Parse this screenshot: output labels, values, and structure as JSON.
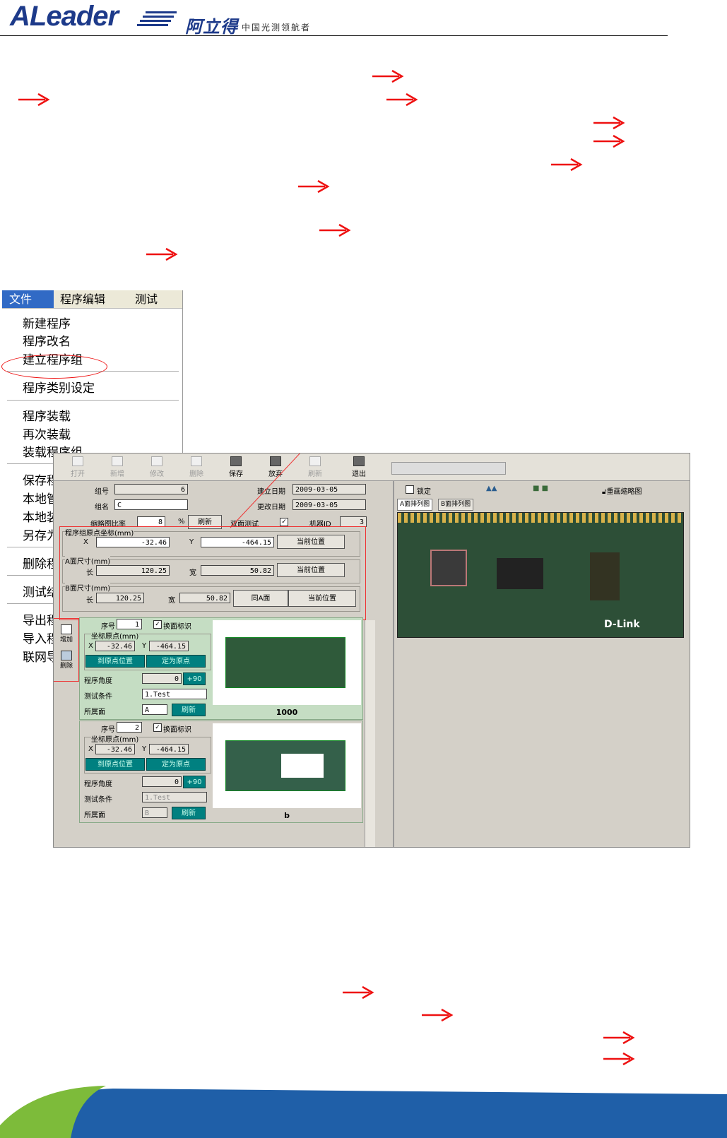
{
  "header": {
    "logo_text": "ALeader",
    "brand_cn": "阿立得",
    "slogan": "中国光测领航者"
  },
  "menu": {
    "bar": [
      "文件",
      "程序编辑",
      "测试"
    ],
    "items": [
      "新建程序",
      "程序改名",
      "建立程序组",
      "程序类别设定",
      "程序装载",
      "再次装载",
      "装载程序组",
      "保存程",
      "本地管",
      "本地装",
      "另存为",
      "删除程",
      "测试结",
      "导出程",
      "导入程",
      "联网导"
    ],
    "highlighted": "建立程序组"
  },
  "toolbar": {
    "buttons": [
      "打开",
      "新增",
      "修改",
      "删除",
      "保存",
      "放弃",
      "刷新",
      "退出"
    ]
  },
  "group_form": {
    "group_no_label": "组号",
    "group_no_value": "6",
    "group_name_label": "组名",
    "group_name_value": "C",
    "scale_label": "缩略图比率",
    "scale_value": "8",
    "percent": "%",
    "refresh_label": "刷新",
    "dual_test_label": "双面测试",
    "create_date_label": "建立日期",
    "create_date_value": "2009-03-05",
    "modify_date_label": "更改日期",
    "modify_date_value": "2009-03-05",
    "machine_id_label": "机器ID",
    "machine_id_value": "3",
    "origin_title": "程序组原点坐标(mm)",
    "x_label": "X",
    "origin_x": "-32.46",
    "y_label": "Y",
    "origin_y": "-464.15",
    "current_pos": "当前位置",
    "a_size_title": "A面尺寸(mm)",
    "len_label": "长",
    "width_label": "宽",
    "a_len": "120.25",
    "a_width": "50.82",
    "b_size_title": "B面尺寸(mm)",
    "b_len": "120.25",
    "b_width": "50.82",
    "same_as_a": "同A面"
  },
  "side_buttons": {
    "add": "增加",
    "delete": "删除"
  },
  "cards": [
    {
      "seq_label": "序号",
      "seq": "1",
      "flip_label": "换面标识",
      "origin_title": "坐标原点(mm)",
      "x": "-32.46",
      "y": "-464.15",
      "goto_origin": "到原点位置",
      "set_origin": "定为原点",
      "angle_label": "程序角度",
      "angle": "0",
      "rotate": "+90",
      "cond_label": "测试条件",
      "cond": "1.Test",
      "side_label": "所属面",
      "side": "A",
      "refresh": "刷新",
      "caption": "1000"
    },
    {
      "seq_label": "序号",
      "seq": "2",
      "flip_label": "换面标识",
      "origin_title": "坐标原点(mm)",
      "x": "-32.46",
      "y": "-464.15",
      "goto_origin": "到原点位置",
      "set_origin": "定为原点",
      "angle_label": "程序角度",
      "angle": "0",
      "rotate": "+90",
      "cond_label": "测试条件",
      "cond": "1.Test",
      "side_label": "所属面",
      "side": "B",
      "refresh": "刷新",
      "caption": "b"
    }
  ],
  "right_panel": {
    "lock_label": "锁定",
    "redraw_label": "重画缩略图",
    "tab_a": "A面排列图",
    "tab_b": "B面排列图",
    "board_marking": "D-Link"
  },
  "colors": {
    "arrow": "#ee1111",
    "brand_blue": "#1d3a8a",
    "menu_selected": "#316ac5",
    "teal_button": "#008080",
    "card_green": "#c5ddc3",
    "banner_green": "#7dbb3a",
    "banner_blue": "#1f5fa8"
  }
}
